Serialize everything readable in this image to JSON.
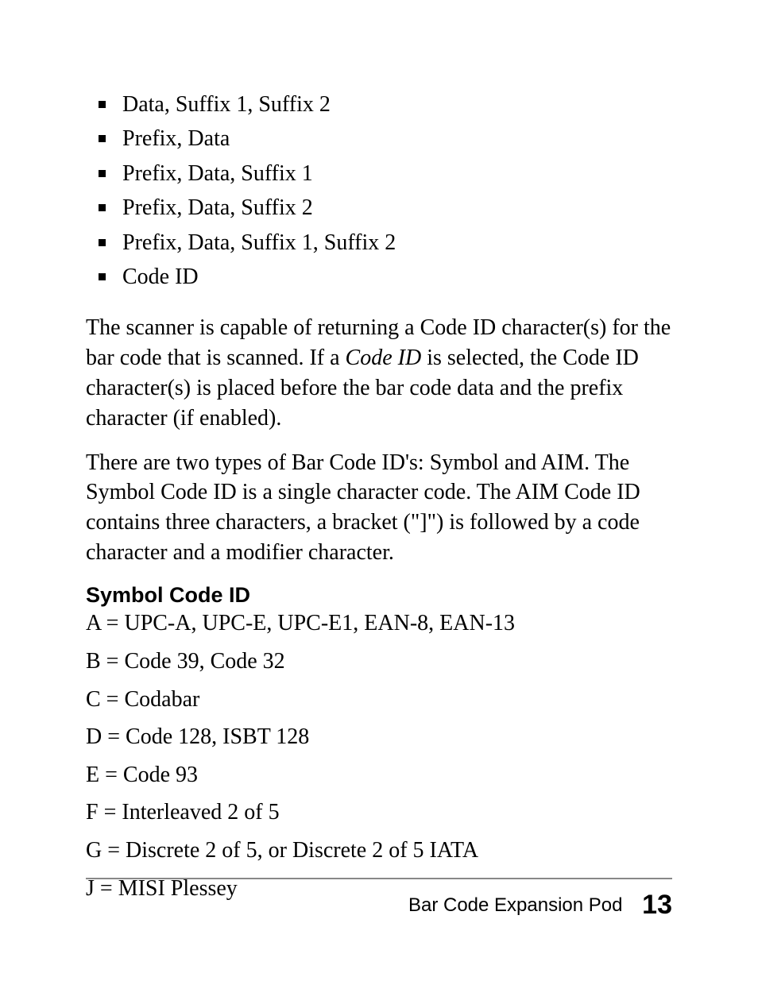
{
  "bullets": [
    "Data, Suffix 1, Suffix 2",
    "Prefix, Data",
    "Prefix, Data, Suffix 1",
    "Prefix, Data, Suffix 2",
    "Prefix, Data, Suffix 1, Suffix 2",
    "Code ID"
  ],
  "para1_a": "The scanner is capable of returning a Code ID character(s) for the bar code that is scanned. If a ",
  "para1_em": "Code ID",
  "para1_b": " is selected, the Code ID character(s) is placed before the bar code data and the prefix character (if enabled).",
  "para2": "There are two types of Bar Code ID's: Symbol and AIM. The Symbol Code ID is a single character code. The AIM Code ID contains three characters, a bracket (\"]\") is followed by a code character and a modifier character.",
  "heading": "Symbol Code ID",
  "defs": [
    "A = UPC-A, UPC-E, UPC-E1, EAN-8, EAN-13",
    "B = Code 39, Code 32",
    "C = Codabar",
    "D = Code 128, ISBT 128",
    "E = Code 93",
    "F = Interleaved 2 of 5",
    "G = Discrete 2 of 5, or Discrete 2 of 5 IATA",
    "J = MISI Plessey"
  ],
  "footer_title": "Bar Code Expansion Pod",
  "page_number": "13"
}
